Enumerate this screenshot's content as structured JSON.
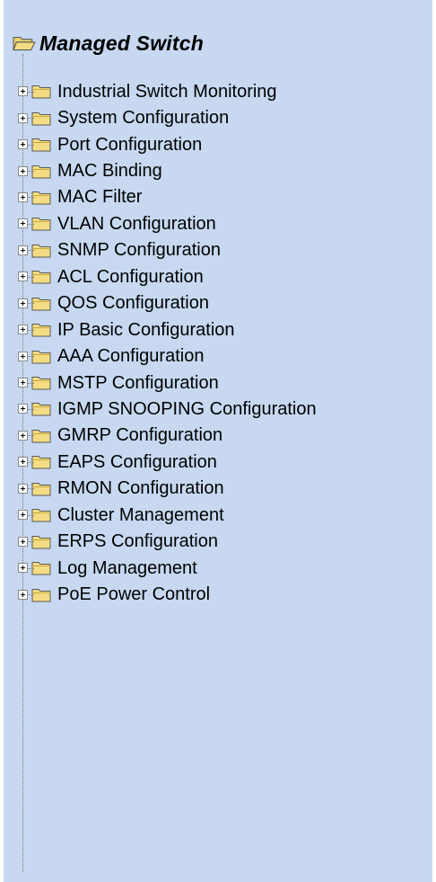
{
  "tree": {
    "root": {
      "label": "Managed Switch",
      "icon": "open-folder-icon"
    },
    "item_icon": "folder-icon",
    "expander_icon": "plus-expander-icon",
    "items": [
      {
        "label": "Industrial Switch Monitoring"
      },
      {
        "label": "System Configuration"
      },
      {
        "label": "Port Configuration"
      },
      {
        "label": "MAC Binding"
      },
      {
        "label": "MAC Filter"
      },
      {
        "label": "VLAN Configuration"
      },
      {
        "label": "SNMP Configuration"
      },
      {
        "label": "ACL Configuration"
      },
      {
        "label": "QOS Configuration"
      },
      {
        "label": "IP Basic Configuration"
      },
      {
        "label": "AAA Configuration"
      },
      {
        "label": "MSTP Configuration"
      },
      {
        "label": "IGMP SNOOPING Configuration"
      },
      {
        "label": "GMRP Configuration"
      },
      {
        "label": "EAPS Configuration"
      },
      {
        "label": "RMON Configuration"
      },
      {
        "label": "Cluster Management"
      },
      {
        "label": "ERPS Configuration"
      },
      {
        "label": "Log Management"
      },
      {
        "label": "PoE Power Control"
      }
    ]
  },
  "colors": {
    "panel_background": "#c7d8f0",
    "folder_fill": "#f3dc83",
    "folder_outline": "#5a5a5a",
    "text": "#000000"
  }
}
